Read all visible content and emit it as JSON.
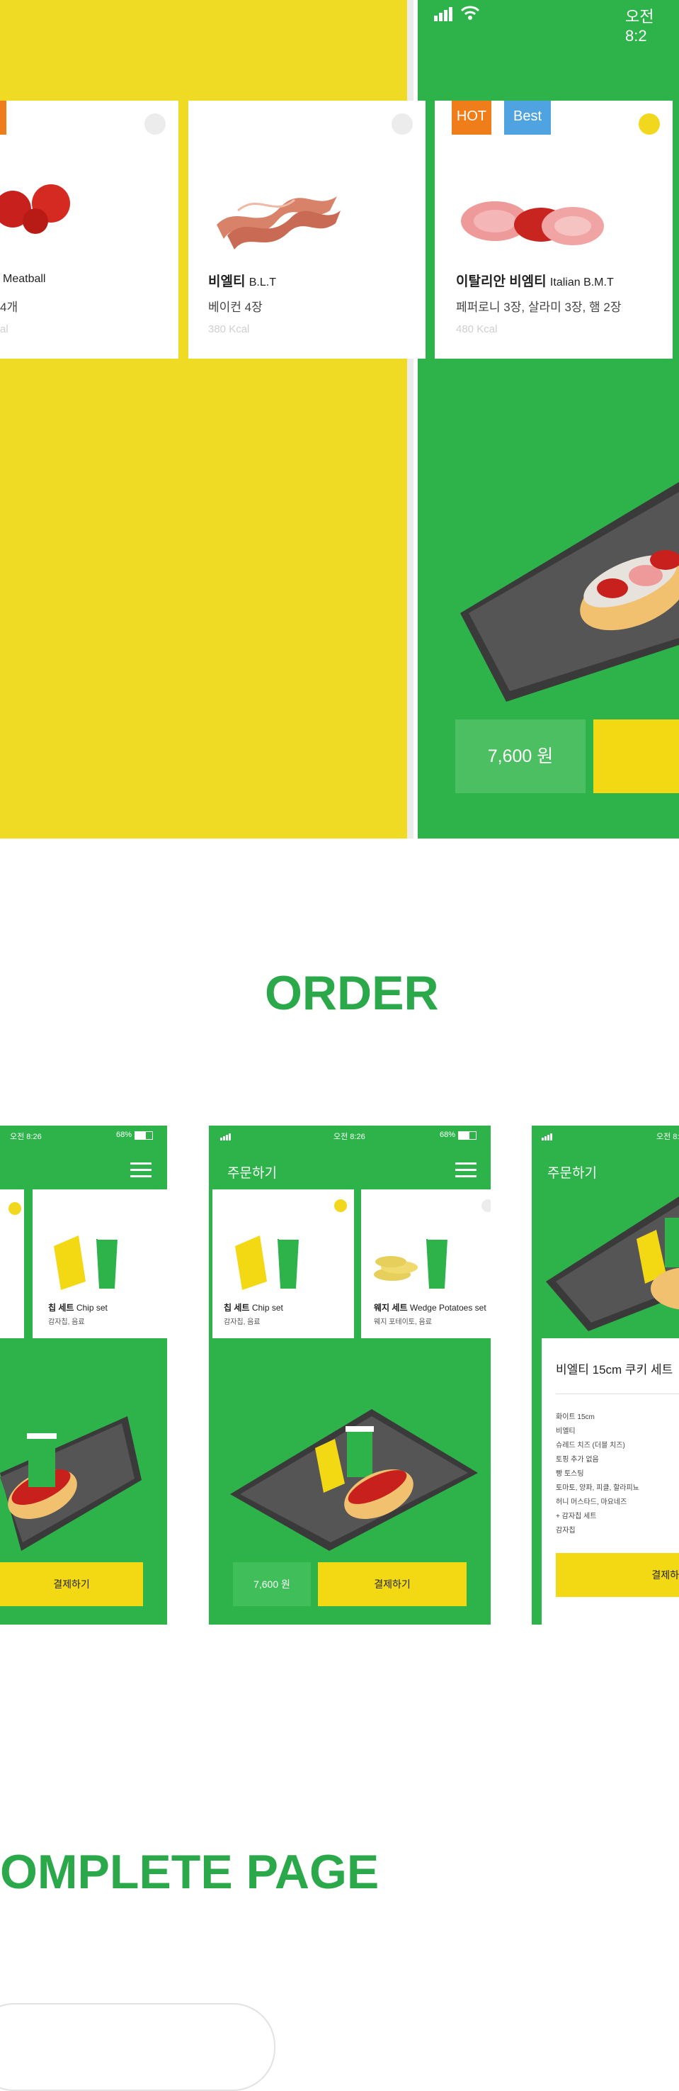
{
  "colors": {
    "brand_green": "#2db34a",
    "brand_yellow": "#efdb24",
    "heading_green": "#2aa84a"
  },
  "top": {
    "status_time": "오전 8:2",
    "cards": [
      {
        "name_ko": "",
        "name_en": "Meatball",
        "desc": "4개",
        "kcal": "al"
      },
      {
        "name_ko": "비엘티",
        "name_en": "B.L.T",
        "desc": "베이컨 4장",
        "kcal": "380 Kcal"
      },
      {
        "name_ko": "이탈리안 비엠티",
        "name_en": "Italian B.M.T",
        "desc": "페퍼로니 3장, 살라미 3장, 햄 2장",
        "kcal": "480 Kcal"
      }
    ],
    "tags": {
      "hot": "HOT",
      "best": "Best"
    },
    "price": "7,600 원"
  },
  "order": {
    "heading": "ORDER",
    "phones": [
      {
        "status_time": "오전 8:26",
        "battery": "68%",
        "cards": [
          {
            "name": "칩 세트",
            "name_en": "Chip set",
            "desc": "감자칩, 음료"
          }
        ],
        "pay_label": "결제하기"
      },
      {
        "status_time": "오전 8:26",
        "battery": "68%",
        "title": "주문하기",
        "cards": [
          {
            "name": "칩 세트",
            "name_en": "Chip set",
            "desc": "감자칩, 음료"
          },
          {
            "name": "웨지 세트",
            "name_en": "Wedge Potatoes set",
            "desc": "웨지 포테이토, 음료"
          }
        ],
        "price": "7,600 원",
        "pay_label": "결제하기"
      },
      {
        "status_time": "오전 8:2",
        "title": "주문하기",
        "sheet_title": "비엘티 15cm 쿠키 세트",
        "sheet_items": [
          "화이트 15cm",
          "비엘티",
          "슈레드 치즈 (더블 치즈)",
          "토핑 추가 없음",
          "빵 토스팅",
          "토마토, 양파, 피클, 할라피뇨",
          "허니 머스타드, 마요네즈",
          "+ 감자칩 세트",
          "감자칩"
        ],
        "pay_label": "결제하"
      }
    ]
  },
  "complete": {
    "heading": "OMPLETE PAGE"
  }
}
